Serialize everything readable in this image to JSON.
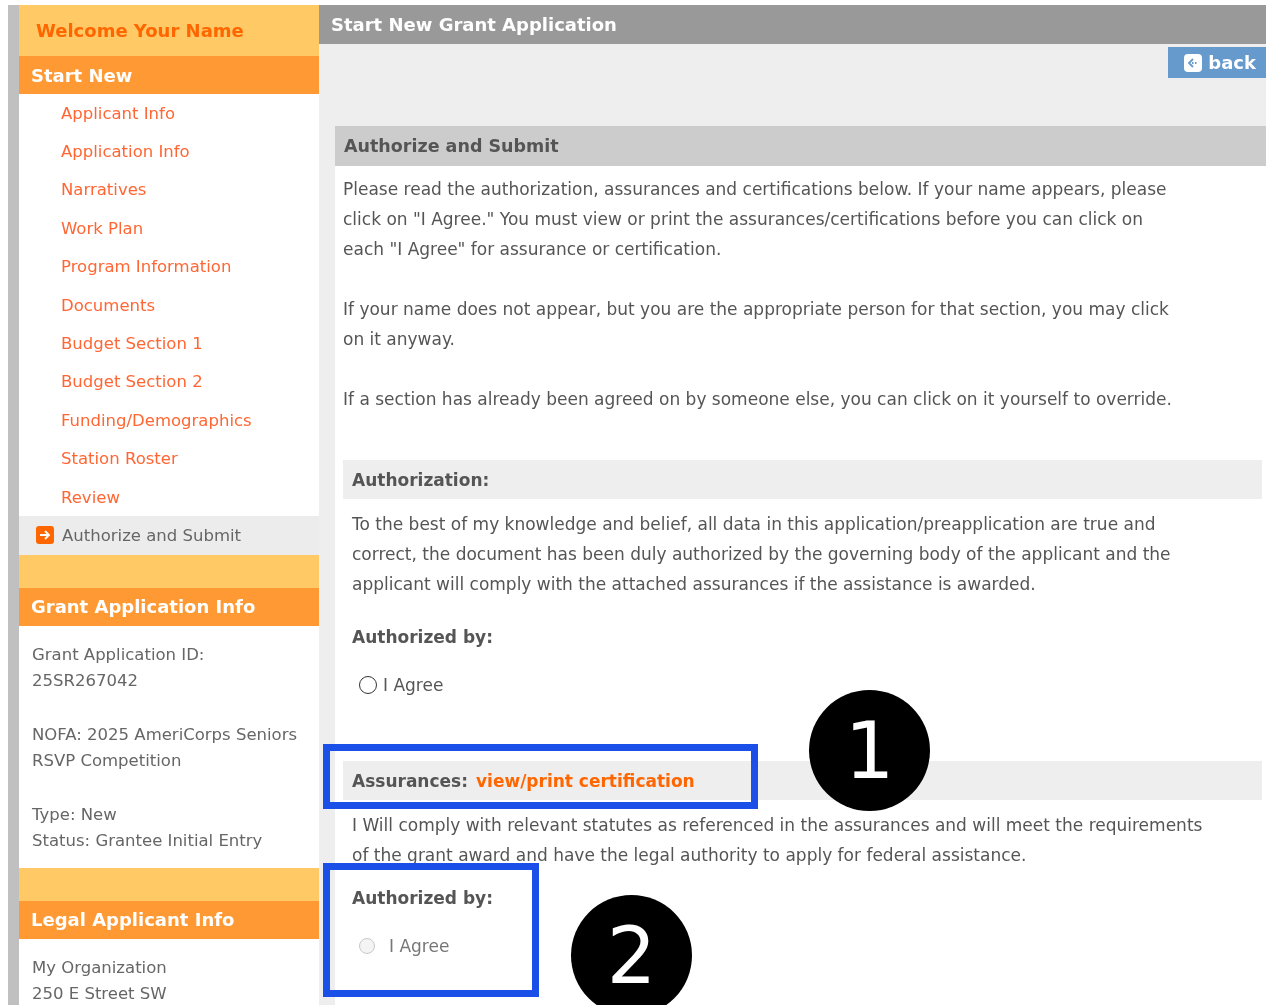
{
  "sidebar": {
    "welcome": "Welcome Your Name",
    "nav": {
      "title": "Start New",
      "items": [
        {
          "label": "Applicant Info",
          "selected": false
        },
        {
          "label": "Application Info",
          "selected": false
        },
        {
          "label": "Narratives",
          "selected": false
        },
        {
          "label": "Work Plan",
          "selected": false
        },
        {
          "label": "Program Information",
          "selected": false
        },
        {
          "label": "Documents",
          "selected": false
        },
        {
          "label": "Budget Section 1",
          "selected": false
        },
        {
          "label": "Budget Section 2",
          "selected": false
        },
        {
          "label": "Funding/Demographics",
          "selected": false
        },
        {
          "label": "Station Roster",
          "selected": false
        },
        {
          "label": "Review",
          "selected": false
        },
        {
          "label": "Authorize and Submit",
          "selected": true
        }
      ]
    },
    "info_sections": [
      {
        "title": "Grant Application Info",
        "paragraphs": [
          [
            "Grant Application ID:",
            "25SR267042"
          ],
          [
            "NOFA: 2025 AmeriCorps Seniors RSVP Competition"
          ],
          [
            "Type: New",
            "Status: Grantee Initial Entry"
          ]
        ]
      },
      {
        "title": "Legal Applicant Info",
        "paragraphs": [
          [
            "My Organization",
            "250 E Street SW"
          ]
        ]
      }
    ]
  },
  "main": {
    "title": "Start New Grant Application",
    "back_button": "back",
    "panel": {
      "title": "Authorize and Submit",
      "intro": [
        "Please read the authorization, assurances and certifications below. If your name appears, please click on \"I Agree.\" You must view or print the assurances/certifications before you can click on each \"I Agree\" for assurance or certification.",
        "If your name does not appear, but you are the appropriate person for that section, you may click on it anyway.",
        "If a section has already been agreed on by someone else, you can click on it yourself to override."
      ],
      "sections": [
        {
          "title": "Authorization:",
          "text": "To the best of my knowledge and belief, all data in this application/preapplication are true and correct, the document has been duly authorized by the governing body of the applicant and the applicant will comply with the attached assurances if the assistance is awarded.",
          "authorized_by": "Authorized by:",
          "radio": {
            "label": "I Agree",
            "selected": false,
            "disabled": false
          }
        },
        {
          "title": "Assurances:",
          "link": "view/print certification",
          "text": "I Will comply with relevant statutes as referenced in the assurances and will meet the requirements of the grant award and have the legal authority to apply for federal assistance.",
          "authorized_by": "Authorized by:",
          "radio": {
            "label": "I Agree",
            "selected": false,
            "disabled": true
          }
        }
      ]
    }
  },
  "annotations": [
    {
      "label": "1"
    },
    {
      "label": "2"
    }
  ]
}
